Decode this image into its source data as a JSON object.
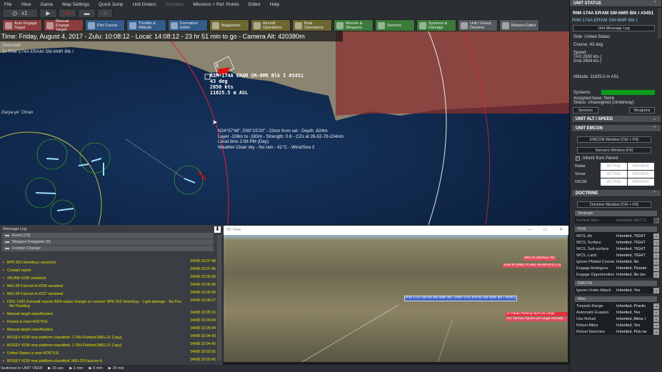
{
  "menu": [
    "File",
    "View",
    "Game",
    "Map Settings",
    "Quick Jump",
    "Unit Orders",
    "Contacts",
    "Missions + Ref. Points",
    "Editor",
    "Help"
  ],
  "clock": {
    "speed": "x1",
    "icons": [
      "clock-icon",
      "play-icon",
      "record-icon",
      "stop-icon",
      "jump-icon"
    ]
  },
  "commands": [
    {
      "label": "Auto Engage Target",
      "color": "red"
    },
    {
      "label": "Manual Engage Target",
      "color": "red"
    },
    {
      "label": "Plot Course",
      "color": "blue"
    },
    {
      "label": "Throttle & Altitude",
      "color": "blue"
    },
    {
      "label": "Formation Editor",
      "color": "blue"
    },
    {
      "label": "Magazines",
      "color": "olive"
    },
    {
      "label": "Aircraft Operations",
      "color": "olive"
    },
    {
      "label": "Boat Operations",
      "color": "olive"
    },
    {
      "label": "Mounts & Weapons",
      "color": "green"
    },
    {
      "label": "Sensors",
      "color": "green"
    },
    {
      "label": "Systems & Damage",
      "color": "green"
    },
    {
      "label": "Unit / Group Doctrine",
      "color": "gray"
    },
    {
      "label": "Mission Editor",
      "color": "gray"
    }
  ],
  "map": {
    "time": "Time: Friday, August 4, 2017 - Zulu: 10:08:12 - Local: 14:08:12 - 23 hr 51 min to go -  Camera Alt: 420380m",
    "selected_label": "Selected:",
    "selected_unit": "1x RIM-174A ERAM SM-6MR Blk I",
    "place": "Darya-ye `Oman",
    "unit_marker": "1",
    "unit_label": [
      "RIM-174A ERAM SM-6MR Blk I #3451",
      "43 deg",
      "2650 kts",
      "11625.5 m ASL"
    ],
    "cursor_info": [
      "N24°57'48\", E60°15'20\" - 23nm from sel - Depth -824m",
      "Layer -108m to -183m - Strength: 0.6 - CZs at 26-52-78-104nm",
      "Local time 2:08 PM (Day)",
      "Weather Clear sky - No rain - 41°C - Wind/Sea 2"
    ],
    "colors": {
      "ocean": "#0f2747",
      "land": "#8a8470",
      "zone": "#8b3030",
      "range": "#e0203a",
      "group": "#e6e040"
    }
  },
  "unit_status": {
    "header": "UNIT STATUS",
    "name": "RIM-174A ERAM SM-6MR Blk I #3451",
    "class": "RIM-174A ERAM SM-6MR Blk I",
    "log_button": "Unit Message Log",
    "side": "Side: United States",
    "course": "Course: 43 deg",
    "speed": "Speed:",
    "tas": "TAS 2650 kts (",
    "gnd": "Gnd 2604 kts (",
    "altitude": "Altitude: 11625.5 m ASL",
    "systems": "Systems:",
    "systems_health": 100,
    "base": "Assigned base: None",
    "status": "Status: Unassigned (Underway)",
    "sensors_button": "Sensors",
    "weapons_button": "Weapons"
  },
  "alt_speed": {
    "header": "UNIT ALT / SPEED"
  },
  "emcon": {
    "header": "UNIT EMCON",
    "window_button": "EMCON Window (Ctrl + F9)",
    "sensors_button": "Sensors Window (F9)",
    "inherit": "Inherit from Parent",
    "inherit_checked": true,
    "rows": [
      {
        "label": "Radar",
        "a": "ACTIVE",
        "p": "PASSIVE"
      },
      {
        "label": "Sonar",
        "a": "ACTIVE",
        "p": "PASSIVE"
      },
      {
        "label": "OECM",
        "a": "ACTIVE",
        "p": "PASSIVE"
      }
    ]
  },
  "doctrine": {
    "header": "DOCTRINE",
    "window_button": "Doctrine Window (Ctrl + F9)",
    "groups": [
      {
        "title": "Strategic",
        "rows": [
          {
            "k": "Nuclear Wpn",
            "v": "Inherited, NOT G",
            "disabled": true
          }
        ]
      },
      {
        "title": "ROE",
        "rows": [
          {
            "k": "WCS, Air",
            "v": "Inherited, TIGHT"
          },
          {
            "k": "WCS, Surface",
            "v": "Inherited, TIGHT"
          },
          {
            "k": "WCS, Sub-surface",
            "v": "Inherited, TIGHT"
          },
          {
            "k": "WCS, Land",
            "v": "Inherited, TIGHT"
          },
          {
            "k": "Ignore Plotted Course",
            "v": "Inherited, No"
          },
          {
            "k": "Engage Ambigous",
            "v": "Inherited, Pessim"
          },
          {
            "k": "Engage Opportunities",
            "v": "Inherited, No (en"
          }
        ]
      },
      {
        "title": "EMCON",
        "rows": [
          {
            "k": "Ignore Under Attack",
            "v": "Inherited, Yes"
          }
        ]
      },
      {
        "title": "Misc",
        "rows": [
          {
            "k": "Torpedo Range",
            "v": "Inherited, Practic"
          },
          {
            "k": "Automatic Evasion",
            "v": "Inherited, Yes"
          },
          {
            "k": "Use Refuel",
            "v": "Inherited, Allow, I"
          },
          {
            "k": "Refuel Allies",
            "v": "Inherited, Yes"
          },
          {
            "k": "Refuel Selection",
            "v": "Inherited, Pick ne"
          }
        ]
      }
    ]
  },
  "log": {
    "title": "Message Log",
    "sections": [
      "Event (13)",
      "Weapon Endgame (0)",
      "Contact Change"
    ],
    "messages": [
      {
        "text": "BPK 810 Smetlivyy vanished",
        "time": "04/08 10:07:48"
      },
      {
        "text": "Contact report",
        "time": "04/08 10:07:45"
      },
      {
        "text": "SKUNK #235 vanished",
        "time": "04/08 10:06:50"
      },
      {
        "text": "MiG-29 Fulcrum A #236 vanished",
        "time": "04/08 10:05:40"
      },
      {
        "text": "MiG-29 Fulcrum A #237 vanished",
        "time": "04/08 10:05:39"
      },
      {
        "text": "DDG 1000 Zumwalt reports BDA status change on contact: BPK 810 Smetlivyy - Light damage - No Fire - No Flooding",
        "time": "04/08 10:05:27"
      },
      {
        "text": "Manual target classification",
        "time": "04/08 10:05:15"
      },
      {
        "text": "Russia is now HOSTILE",
        "time": "04/08 10:05:04"
      },
      {
        "text": "Manual target classification",
        "time": "04/08 10:05:04"
      },
      {
        "text": "BOGEY #239 now platform-classified: J-7IIH Fishbed [MiG-21 Copy]",
        "time": "04/08 10:04:43"
      },
      {
        "text": "BOGEY #238 now platform-classified: J-7IIH Fishbed [MiG-21 Copy]",
        "time": "04/08 10:04:43"
      },
      {
        "text": "United States is now HOSTILE",
        "time": "04/08 10:03:55"
      },
      {
        "text": "BOGEY #236 now platform-classified: MiG-29 Fulcrum A",
        "time": "04/08 10:03:42"
      }
    ]
  },
  "statusbar": {
    "text": "Switched to UNIT VIEW",
    "steps": [
      "15 sec",
      "1 min",
      "5 min",
      "15 min"
    ]
  },
  "view3d": {
    "title": "3D View",
    "tags": {
      "mig": "MiG-21 (Merkun #2)",
      "sam": "SAM Pt (RBS 70 Mk1 MANPADS x 3)",
      "own": "RIM-174A ERAM SM-6MR Blk I (RIM-174A ERAM SM-6MR Blk I #3451)",
      "site1": "(C Clean Parking Spot (Is Large",
      "site2": "A/C Tarmac Space (2x Large Aircraft)"
    }
  }
}
